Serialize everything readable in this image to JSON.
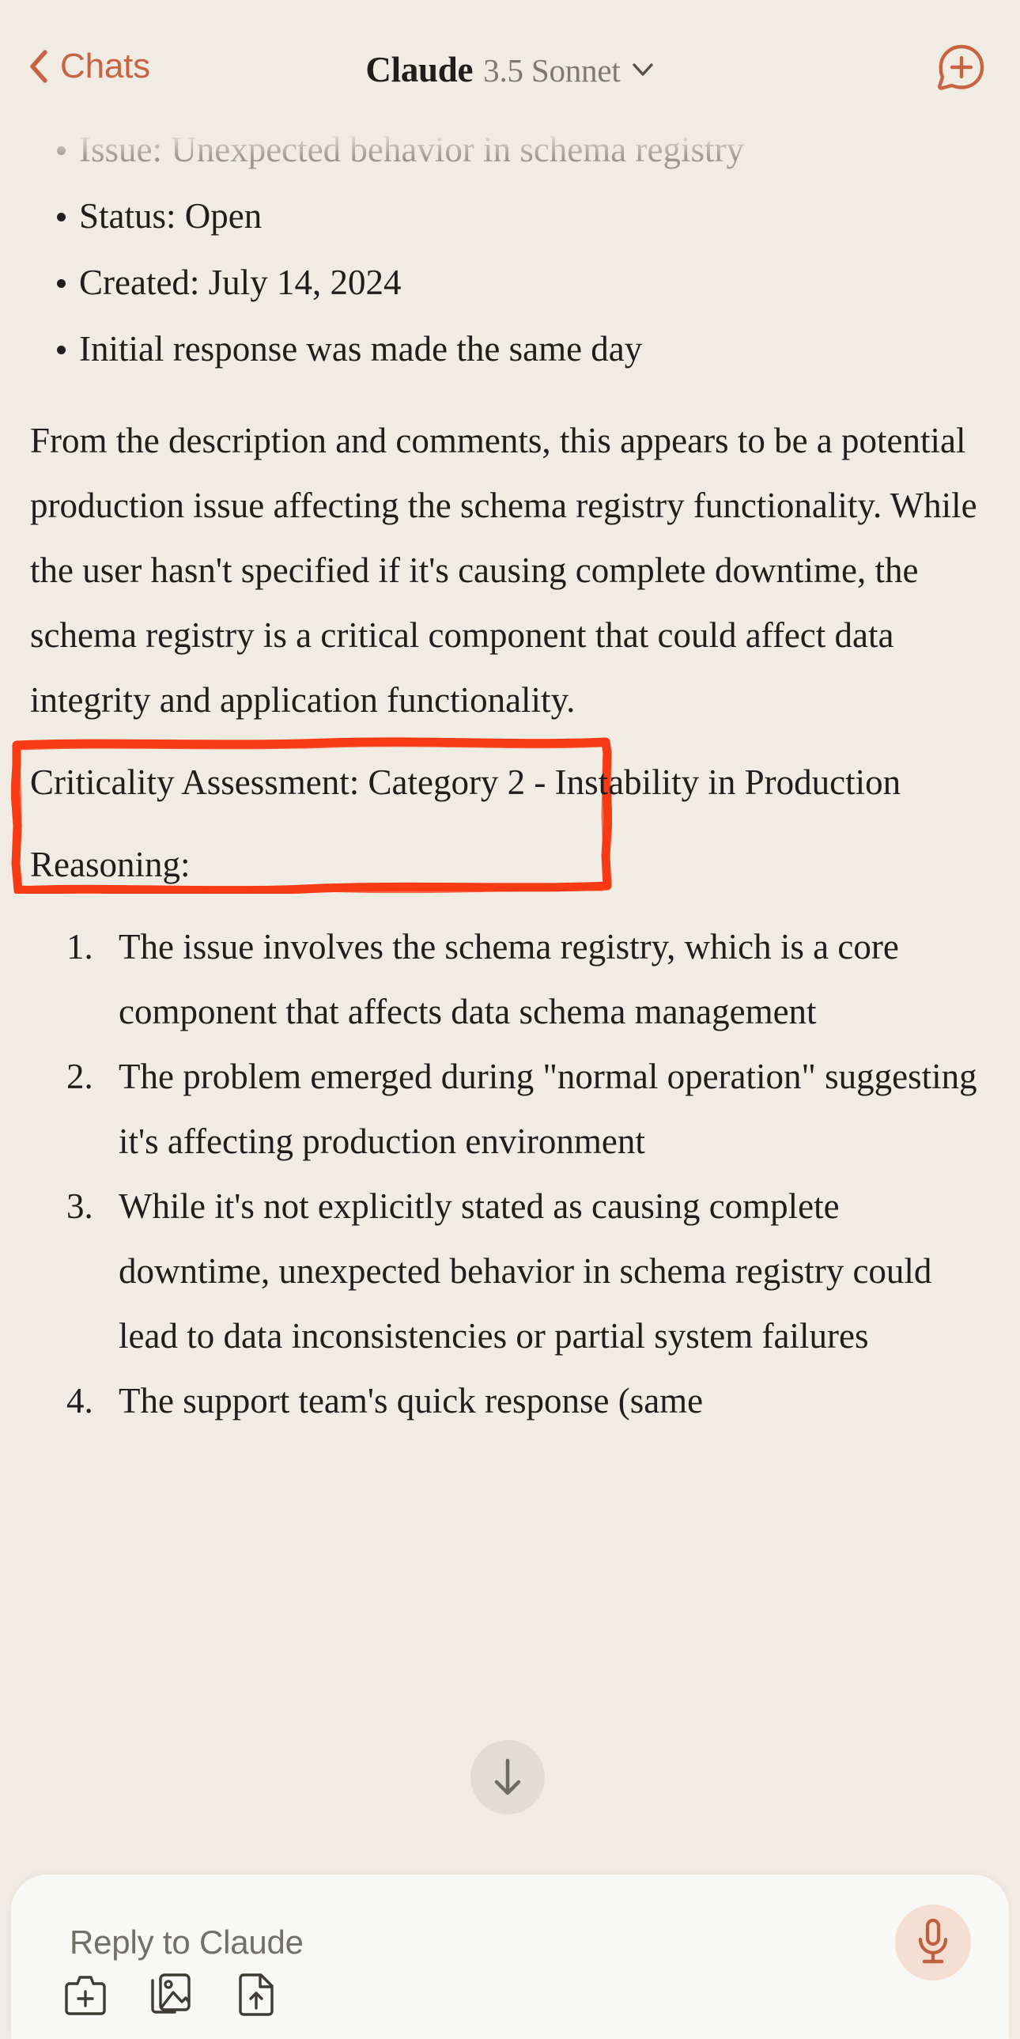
{
  "header": {
    "back_label": "Chats",
    "title_main": "Claude",
    "title_model": "3.5 Sonnet",
    "back_icon": "chevron-left-icon",
    "model_chevron_icon": "chevron-down-icon",
    "new_chat_icon": "new-chat-bubble-plus-icon",
    "accent_color": "#c96442"
  },
  "conversation": {
    "bullets": [
      {
        "text": "Issue: Unexpected behavior in schema registry",
        "faded": true
      },
      {
        "text": "Status: Open",
        "faded": false
      },
      {
        "text": "Created: July 14, 2024",
        "faded": false
      },
      {
        "text": "Initial response was made the same day",
        "faded": false
      }
    ],
    "paragraph": "From the description and comments, this appears to be a potential production issue affecting the schema registry functionality. While the user hasn't specified if it's causing complete downtime, the schema registry is a critical component that could affect data integrity and application functionality.",
    "highlight": {
      "text": "Criticality Assessment: Category 2 - Instability in Production",
      "box_color": "#f83b14"
    },
    "reasoning_label": "Reasoning:",
    "reasons": [
      "The issue involves the schema registry, which is a core component that affects data schema management",
      "The problem emerged during \"normal operation\" suggesting it's affecting production environment",
      "While it's not explicitly stated as causing complete downtime, unexpected behavior in schema registry could lead to data inconsistencies or partial system failures",
      "The support team's quick response (same"
    ]
  },
  "scroll_button": {
    "icon": "arrow-down-icon"
  },
  "composer": {
    "placeholder": "Reply to Claude",
    "attach_icon": "camera-plus-icon",
    "photo_icon": "photo-library-icon",
    "file_icon": "file-upload-icon",
    "mic_icon": "microphone-icon",
    "mic_color": "#c15f3c"
  }
}
